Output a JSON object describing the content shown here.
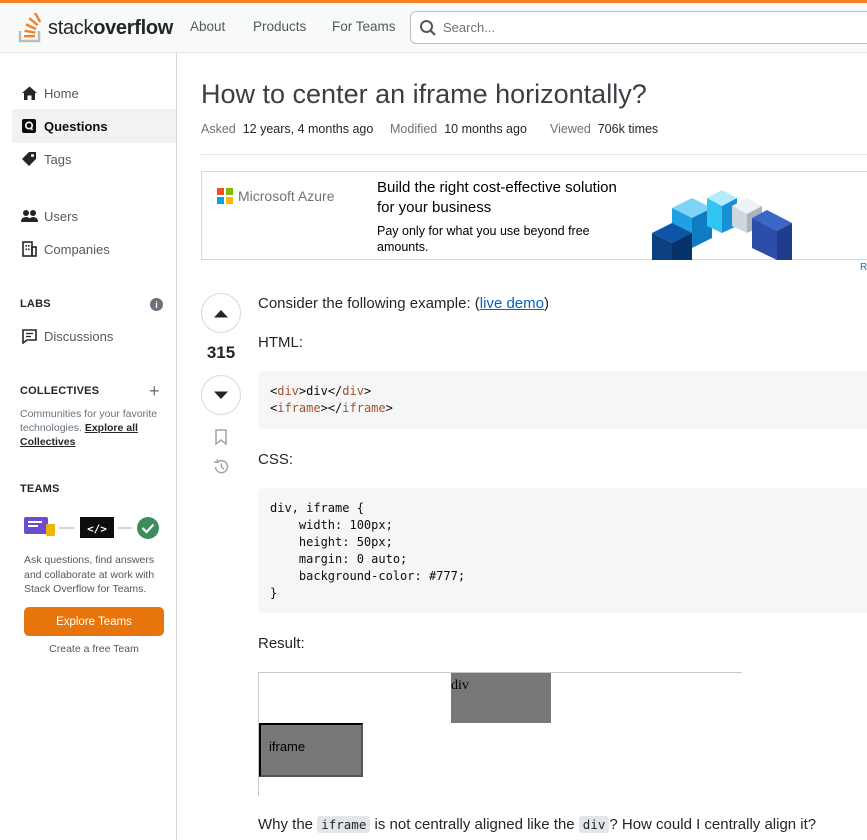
{
  "header": {
    "logo_text_light": "stack",
    "logo_text_bold": "overflow",
    "nav": [
      "About",
      "Products",
      "For Teams"
    ],
    "search_placeholder": "Search..."
  },
  "sidebar": {
    "items": [
      {
        "label": "Home",
        "icon": "home-icon"
      },
      {
        "label": "Questions",
        "icon": "questions-icon",
        "active": true
      },
      {
        "label": "Tags",
        "icon": "tag-icon"
      },
      {
        "label": "Users",
        "icon": "users-icon"
      },
      {
        "label": "Companies",
        "icon": "companies-icon"
      }
    ],
    "labs_heading": "LABS",
    "discussions_label": "Discussions",
    "collectives_heading": "COLLECTIVES",
    "collectives_text": "Communities for your favorite technologies.",
    "collectives_link": "Explore all Collectives",
    "teams_heading": "TEAMS",
    "teams_text": "Ask questions, find answers and collaborate at work with Stack Overflow for Teams.",
    "explore_teams": "Explore Teams",
    "create_free_team": "Create a free Team"
  },
  "question": {
    "title": "How to center an iframe horizontally?",
    "asked_label": "Asked",
    "asked_value": "12 years, 4 months ago",
    "modified_label": "Modified",
    "modified_value": "10 months ago",
    "viewed_label": "Viewed",
    "viewed_value": "706k times",
    "votes": "315"
  },
  "ad": {
    "brand": "Microsoft Azure",
    "headline": "Build the right cost-effective solution for your business",
    "subtext": "Pay only for what you use beyond free amounts.",
    "corner": "R"
  },
  "body": {
    "intro_text": "Consider the following example: (",
    "intro_link": "live demo",
    "intro_close": ")",
    "html_label": "HTML:",
    "html_code_line1_a": "<",
    "html_code_line1_tag": "div",
    "html_code_line1_b": ">div</",
    "html_code_line1_tag2": "div",
    "html_code_line1_c": ">",
    "html_code_line2_a": "<",
    "html_code_line2_tag": "iframe",
    "html_code_line2_b": "></",
    "html_code_line2_tag2": "iframe",
    "html_code_line2_c": ">",
    "css_label": "CSS:",
    "css_code": "div, iframe {\n    width: 100px;\n    height: 50px;\n    margin: 0 auto;\n    background-color: #777;\n}",
    "result_label": "Result:",
    "result_div_text": "div",
    "result_iframe_text": "iframe",
    "question_pre": "Why the ",
    "question_code1": "iframe",
    "question_mid": " is not centrally aligned like the ",
    "question_code2": "div",
    "question_post": "? How could I centrally align it?"
  }
}
